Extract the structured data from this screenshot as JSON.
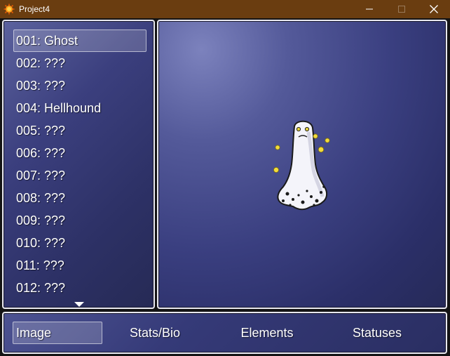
{
  "window": {
    "title": "Project4",
    "icon": "rpgmaker-app-icon"
  },
  "bestiary": {
    "selected_index": 0,
    "entries": [
      {
        "label": "001: Ghost"
      },
      {
        "label": "002: ???"
      },
      {
        "label": "003: ???"
      },
      {
        "label": "004: Hellhound"
      },
      {
        "label": "005: ???"
      },
      {
        "label": "006: ???"
      },
      {
        "label": "007: ???"
      },
      {
        "label": "008: ???"
      },
      {
        "label": "009: ???"
      },
      {
        "label": "010: ???"
      },
      {
        "label": "011: ???"
      },
      {
        "label": "012: ???"
      }
    ],
    "scroll_indicator": "down-arrow-icon"
  },
  "preview": {
    "sprite": "ghost-enemy-sprite"
  },
  "tabs": {
    "selected_index": 0,
    "items": [
      {
        "label": "Image"
      },
      {
        "label": "Stats/Bio"
      },
      {
        "label": "Elements"
      },
      {
        "label": "Statuses"
      }
    ]
  },
  "colors": {
    "titlebar": "#6a3d10",
    "window_border": "#e8e8f0",
    "window_bg": "#2d3166",
    "text": "#ffffff"
  }
}
